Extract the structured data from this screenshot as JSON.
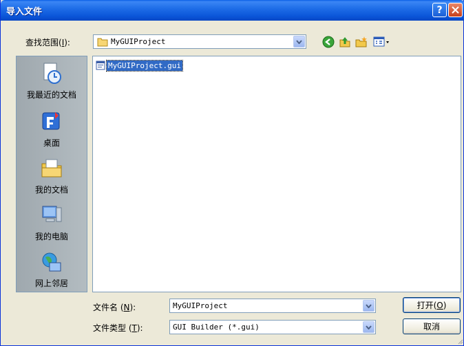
{
  "window": {
    "title": "导入文件"
  },
  "look_in": {
    "label": "查找范围",
    "accel": "I",
    "value": "MyGUIProject"
  },
  "places": [
    {
      "label": "我最近的文档"
    },
    {
      "label": "桌面"
    },
    {
      "label": "我的文档"
    },
    {
      "label": "我的电脑"
    },
    {
      "label": "网上邻居"
    }
  ],
  "files": [
    {
      "name": "MyGUIProject.gui",
      "selected": true
    }
  ],
  "filename": {
    "label": "文件名",
    "accel": "N",
    "value": "MyGUIProject"
  },
  "filetype": {
    "label": "文件类型",
    "accel": "T",
    "value": "GUI Builder (*.gui)"
  },
  "buttons": {
    "open": "打开",
    "open_accel": "O",
    "cancel": "取消"
  },
  "colors": {
    "title_blue": "#0a54d8",
    "selection": "#316ac5",
    "close_red": "#c6401b"
  }
}
